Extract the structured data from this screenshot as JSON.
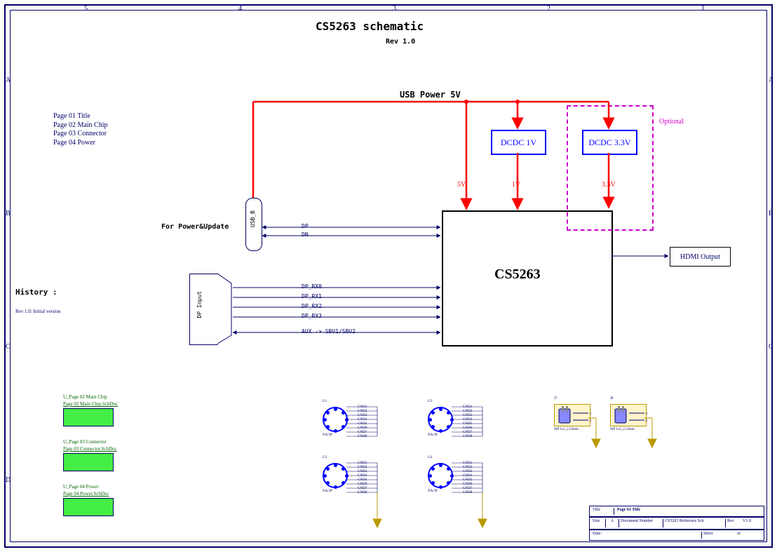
{
  "title": "CS5263  schematic",
  "rev": "Rev 1.0",
  "page_list": [
    "Page 01 Title",
    "Page 02 Main Chip",
    "Page 03 Connector",
    "Page 04 Power"
  ],
  "history_heading": "History :",
  "history": "Rev 1.0: Initial version",
  "diagram": {
    "usb_power_label": "USB Power 5V",
    "dcdc1": "DCDC 1V",
    "dcdc2": "DCDC 3.3V",
    "optional": "Optional",
    "v5": "5V",
    "v1": "1V",
    "v33": "3.3V",
    "for_power_update": "For Power&Update",
    "usb_b": "USB_B",
    "dp": "DP",
    "dn": "DN",
    "dp_input": "DP Input",
    "dp_rx": [
      "DP_RX0",
      "DP_RX1",
      "DP_RX2",
      "DP_RX3"
    ],
    "aux": "AUX -> SBU1/SBU2",
    "chip": "CS5263",
    "hdmi": "HDMI Output"
  },
  "hier_blocks": [
    {
      "ref": "U_Page 02 Main Chip",
      "file": "Page 02 Main Chip.SchDoc"
    },
    {
      "ref": "U_Page 03 Connector",
      "file": "Page 03 Connector.SchDoc"
    },
    {
      "ref": "U_Page 04 Power",
      "file": "Page 04 Power.SchDoc"
    }
  ],
  "mounting_holes": {
    "refs": [
      "G1",
      "G2",
      "G3",
      "G4"
    ],
    "value": "NA/3P",
    "pins": [
      "GND1",
      "GND2",
      "GND3",
      "GND4",
      "GND5",
      "GND6",
      "GND7",
      "GND8"
    ]
  },
  "jumpers": {
    "refs": [
      "J7",
      "J8"
    ],
    "footprint": "SIP 1x2_2.54mm"
  },
  "title_block": {
    "title_label": "Title",
    "title": "Page 01 Title",
    "size_label": "Size",
    "size": "A",
    "docnum_label": "Document Number",
    "docnum": "CS5263 Reference Sch",
    "rev_label": "Rev",
    "rev": "V1.0",
    "date_label": "Date:",
    "sheet_label": "Sheet",
    "of": "of"
  },
  "zones": {
    "cols": [
      "5",
      "4",
      "3",
      "2",
      "1"
    ],
    "rows": [
      "A",
      "B",
      "C",
      "D"
    ]
  }
}
